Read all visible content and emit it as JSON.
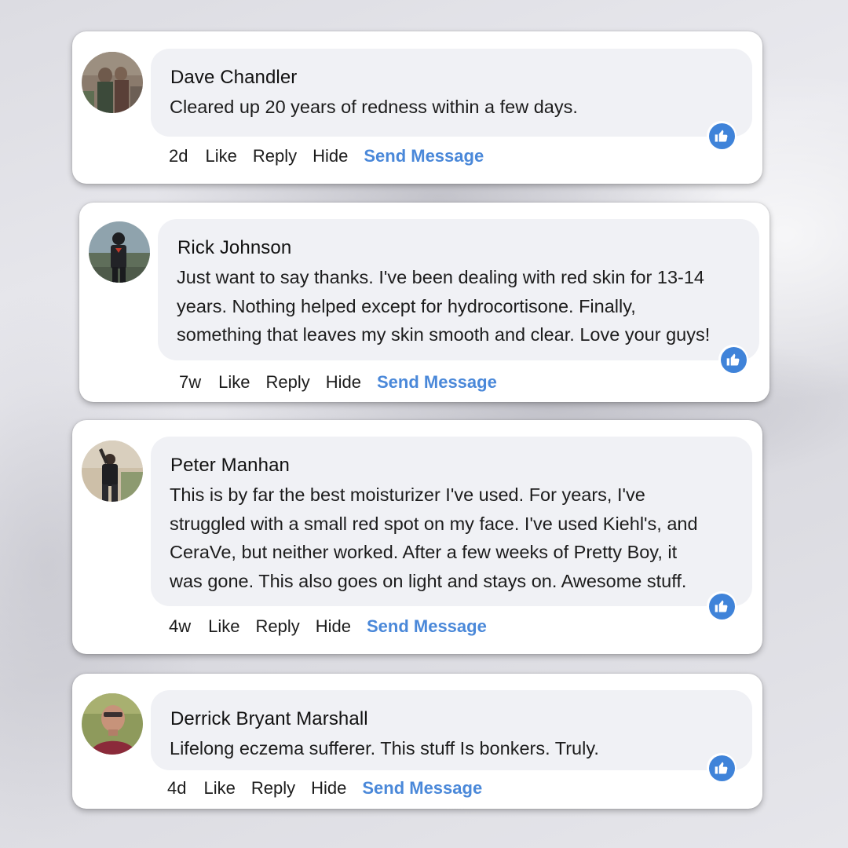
{
  "comments": [
    {
      "name": "Dave Chandler",
      "text": "Cleared up 20 years of redness within a few days.",
      "time": "2d",
      "actions": {
        "like": "Like",
        "reply": "Reply",
        "hide": "Hide",
        "send_message": "Send Message"
      },
      "icon": "thumbs-up-icon",
      "like_color": "#3f83d9"
    },
    {
      "name": "Rick Johnson",
      "text": "Just want to say thanks. I've been dealing with red skin for 13-14\nyears. Nothing helped except for hydrocortisone. Finally,\nsomething that leaves my skin smooth and clear. Love your guys!",
      "time": "7w",
      "actions": {
        "like": "Like",
        "reply": "Reply",
        "hide": "Hide",
        "send_message": "Send Message"
      },
      "icon": "thumbs-up-icon",
      "like_color": "#3f83d9"
    },
    {
      "name": "Peter Manhan",
      "text": " This is by far the best moisturizer I've used. For years, I've\nstruggled with a small red spot on my face. I've used Kiehl's, and\nCeraVe, but neither worked. After a few weeks of Pretty Boy, it\nwas gone. This also goes on light and stays on. Awesome stuff.",
      "time": "4w",
      "actions": {
        "like": "Like",
        "reply": "Reply",
        "hide": "Hide",
        "send_message": "Send Message"
      },
      "icon": "thumbs-up-icon",
      "like_color": "#3f83d9"
    },
    {
      "name": "Derrick Bryant Marshall",
      "text": "Lifelong eczema sufferer. This stuff Is bonkers. Truly.",
      "time": "4d",
      "actions": {
        "like": "Like",
        "reply": "Reply",
        "hide": "Hide",
        "send_message": "Send Message"
      },
      "icon": "thumbs-up-icon",
      "like_color": "#3f83d9"
    }
  ],
  "colors": {
    "link": "#4a88d9",
    "bubble": "#f0f1f5",
    "card": "#ffffff"
  }
}
